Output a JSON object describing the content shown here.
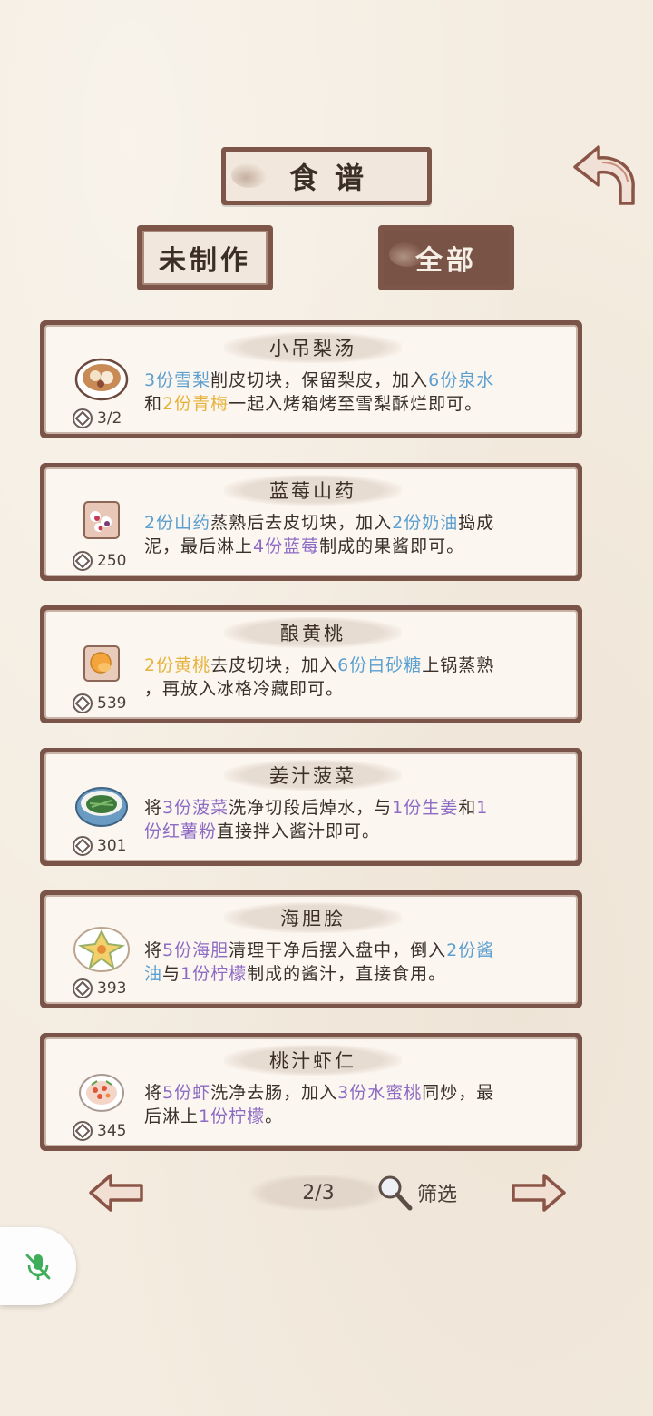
{
  "header": {
    "title": "食谱"
  },
  "tabs": [
    {
      "label": "未制作"
    },
    {
      "label": "全部"
    }
  ],
  "recipes": [
    {
      "name": "小吊梨汤",
      "count": "3/2",
      "icon": "pear-soup-bowl-icon",
      "line1": [
        {
          "t": "3份雪梨",
          "c": "blue"
        },
        {
          "t": "削皮切块，保留梨皮，加入",
          "c": ""
        },
        {
          "t": "6份泉水",
          "c": "blue"
        }
      ],
      "line2": [
        {
          "t": "和",
          "c": ""
        },
        {
          "t": "2份青梅",
          "c": "yellow"
        },
        {
          "t": "一起入烤箱烤至雪梨酥烂即可。",
          "c": ""
        }
      ]
    },
    {
      "name": "蓝莓山药",
      "count": "250",
      "icon": "blueberry-yam-plate-icon",
      "line1": [
        {
          "t": "2份山药",
          "c": "blue"
        },
        {
          "t": "蒸熟后去皮切块，加入",
          "c": ""
        },
        {
          "t": "2份奶油",
          "c": "blue"
        },
        {
          "t": "捣成",
          "c": ""
        }
      ],
      "line2": [
        {
          "t": "泥，最后淋上",
          "c": ""
        },
        {
          "t": "4份蓝莓",
          "c": "purple"
        },
        {
          "t": "制成的果酱即可。",
          "c": ""
        }
      ]
    },
    {
      "name": "酿黄桃",
      "count": "539",
      "icon": "yellow-peach-plate-icon",
      "line1": [
        {
          "t": "2份黄桃",
          "c": "yellow"
        },
        {
          "t": "去皮切块，加入",
          "c": ""
        },
        {
          "t": "6份白砂糖",
          "c": "blue"
        },
        {
          "t": "上锅蒸熟",
          "c": ""
        }
      ],
      "line2": [
        {
          "t": "，再放入冰格冷藏即可。",
          "c": ""
        }
      ]
    },
    {
      "name": "姜汁菠菜",
      "count": "301",
      "icon": "spinach-bowl-icon",
      "line1": [
        {
          "t": "将",
          "c": ""
        },
        {
          "t": "3份菠菜",
          "c": "purple"
        },
        {
          "t": "洗净切段后焯水，与",
          "c": ""
        },
        {
          "t": "1份生姜",
          "c": "purple"
        },
        {
          "t": "和",
          "c": ""
        },
        {
          "t": "1",
          "c": "purple"
        }
      ],
      "line2": [
        {
          "t": "份红薯粉",
          "c": "purple"
        },
        {
          "t": "直接拌入酱汁即可。",
          "c": ""
        }
      ]
    },
    {
      "name": "海胆脍",
      "count": "393",
      "icon": "sea-urchin-plate-icon",
      "line1": [
        {
          "t": "将",
          "c": ""
        },
        {
          "t": "5份海胆",
          "c": "purple"
        },
        {
          "t": "清理干净后摆入盘中，倒入",
          "c": ""
        },
        {
          "t": "2份酱",
          "c": "blue"
        }
      ],
      "line2": [
        {
          "t": "油",
          "c": "blue"
        },
        {
          "t": "与",
          "c": ""
        },
        {
          "t": "1份柠檬",
          "c": "purple"
        },
        {
          "t": "制成的酱汁，直接食用。",
          "c": ""
        }
      ]
    },
    {
      "name": "桃汁虾仁",
      "count": "345",
      "icon": "shrimp-plate-icon",
      "line1": [
        {
          "t": "将",
          "c": ""
        },
        {
          "t": "5份虾",
          "c": "purple"
        },
        {
          "t": "洗净去肠，加入",
          "c": ""
        },
        {
          "t": "3份水蜜桃",
          "c": "purple"
        },
        {
          "t": "同炒，最",
          "c": ""
        }
      ],
      "line2": [
        {
          "t": "后淋上",
          "c": ""
        },
        {
          "t": "1份柠檬",
          "c": "purple"
        },
        {
          "t": "。",
          "c": ""
        }
      ]
    }
  ],
  "pagination": {
    "page": "2/3",
    "filter_label": "筛选"
  },
  "colors": {
    "frame_brown": "#7d5649",
    "paper": "#f4ece0",
    "ingredient_blue": "#5b9fd0",
    "ingredient_yellow": "#e6b23c",
    "ingredient_purple": "#8d6bc4",
    "mic_green": "#3fae5a"
  }
}
